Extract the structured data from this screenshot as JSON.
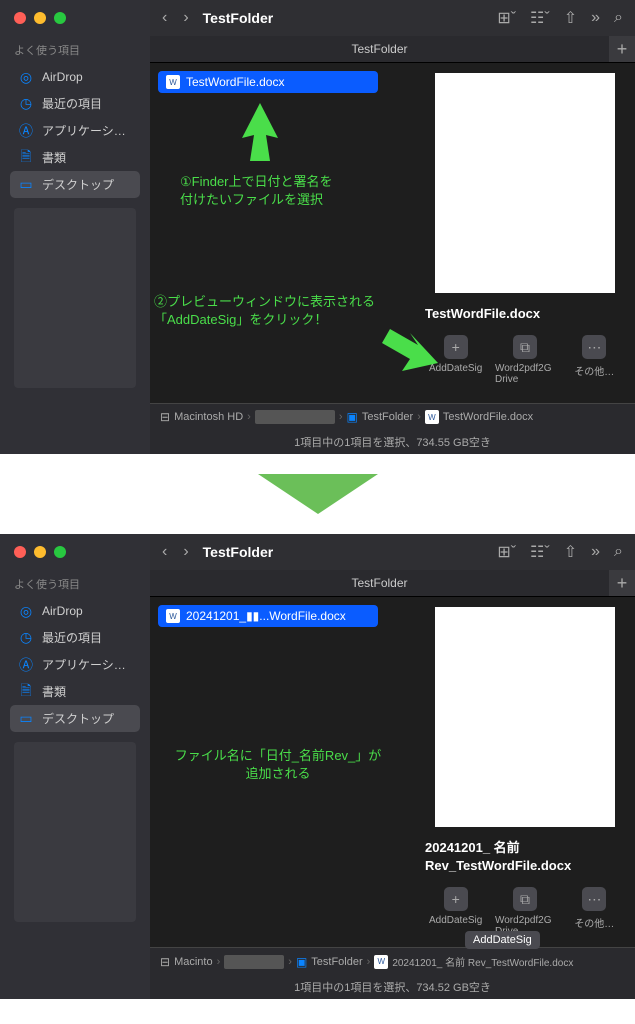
{
  "window1": {
    "title": "TestFolder",
    "tab": "TestFolder",
    "sidebar": {
      "header": "よく使う項目",
      "items": [
        {
          "label": "AirDrop",
          "icon": "airdrop"
        },
        {
          "label": "最近の項目",
          "icon": "clock"
        },
        {
          "label": "アプリケーシ…",
          "icon": "apps"
        },
        {
          "label": "書類",
          "icon": "doc"
        },
        {
          "label": "デスクトップ",
          "icon": "desktop",
          "active": true
        }
      ]
    },
    "file": "TestWordFile.docx",
    "preview_name": "TestWordFile.docx",
    "actions": [
      {
        "label": "AddDateSig",
        "icon": "+"
      },
      {
        "label": "Word2pdf2G Drive",
        "icon": "⧉"
      },
      {
        "label": "その他…",
        "icon": "⋯"
      }
    ],
    "path": {
      "disk": "Macintosh HD",
      "folder": "TestFolder",
      "file": "TestWordFile.docx"
    },
    "status": "1項目中の1項目を選択、734.55 GB空き",
    "annotation1": "①Finder上で日付と署名を\n付けたいファイルを選択",
    "annotation2": "②プレビューウィンドウに表示される\n「AddDateSig」をクリック！"
  },
  "window2": {
    "title": "TestFolder",
    "tab": "TestFolder",
    "file": "20241201_▮▮...WordFile.docx",
    "preview_name": "20241201_ 名前 Rev_TestWordFile.docx",
    "actions": [
      {
        "label": "AddDateSig",
        "icon": "+"
      },
      {
        "label": "Word2pdf2G Drive",
        "icon": "⧉"
      },
      {
        "label": "その他…",
        "icon": "⋯"
      }
    ],
    "path": {
      "disk": "Macinto",
      "folder": "TestFolder",
      "file": "20241201_ 名前 Rev_TestWordFile.docx"
    },
    "status": "1項目中の1項目を選択、734.52 GB空き",
    "annotation": "ファイル名に「日付_名前Rev_」が\n追加される",
    "tooltip": "AddDateSig"
  }
}
